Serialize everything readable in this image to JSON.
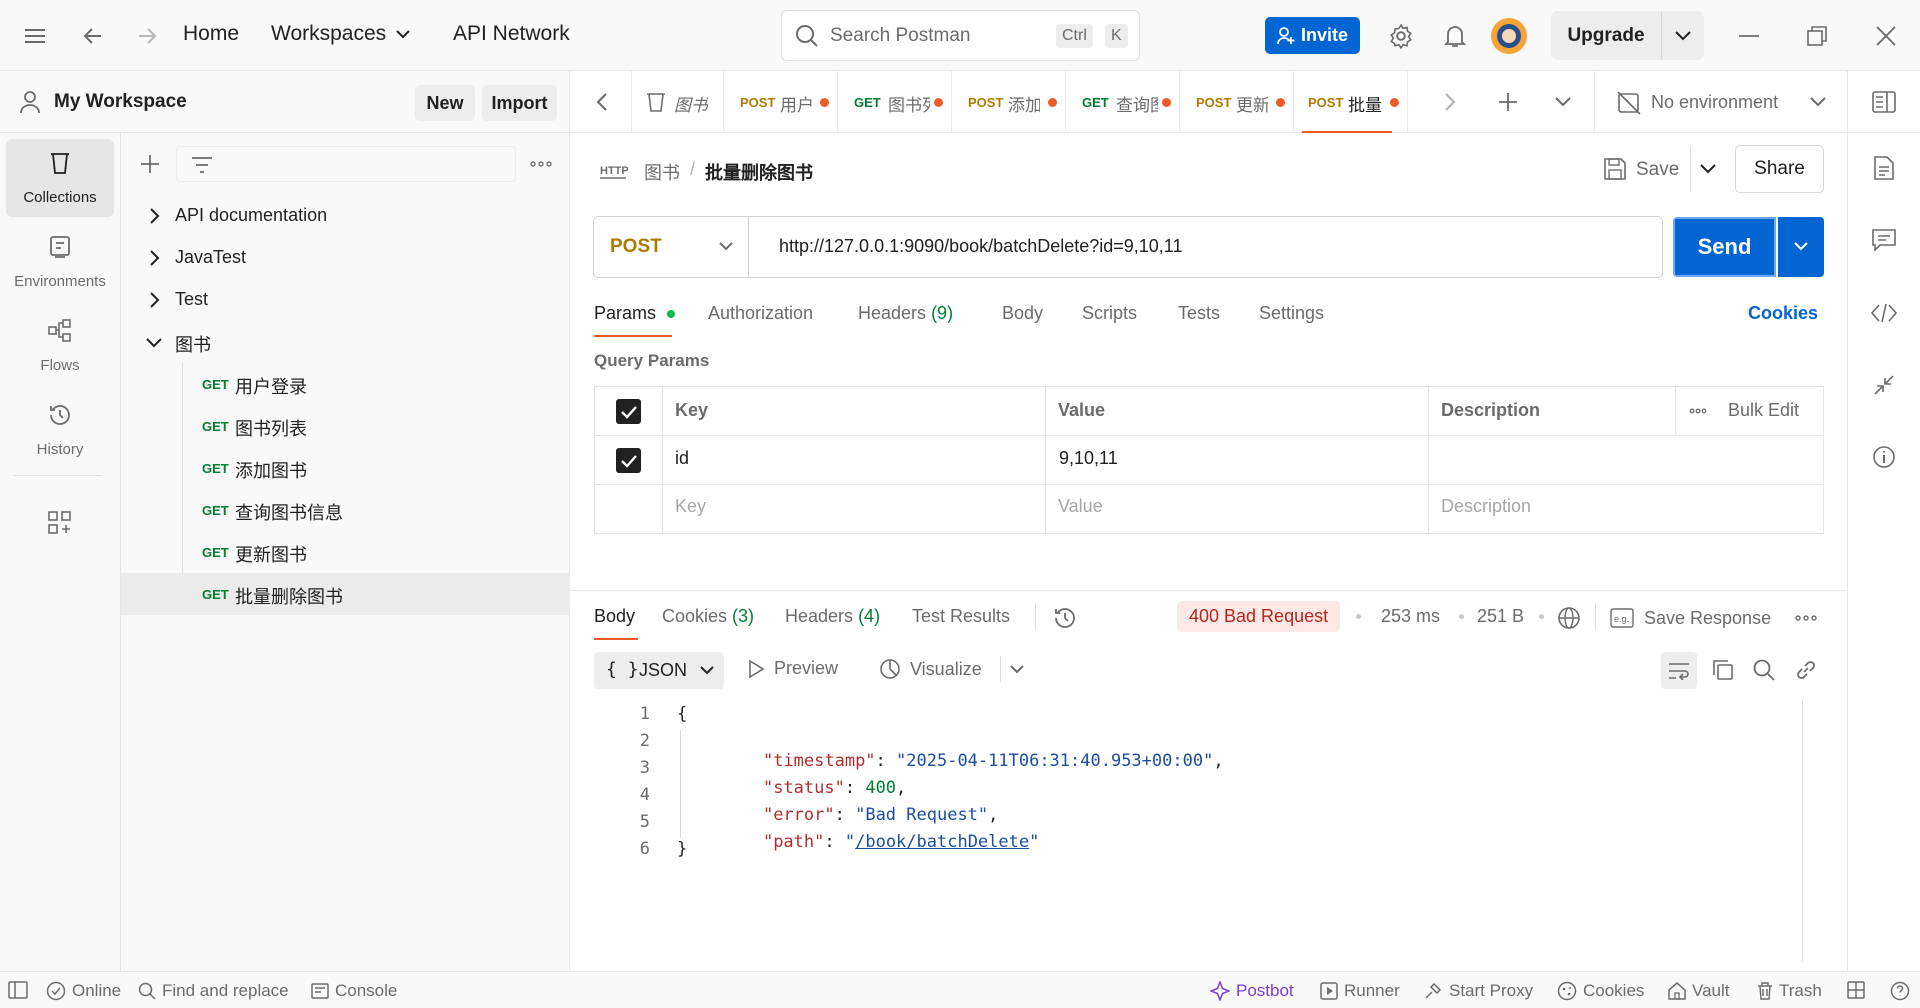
{
  "topbar": {
    "home": "Home",
    "workspaces": "Workspaces",
    "api_network": "API Network",
    "search_placeholder": "Search Postman",
    "kbd_ctrl": "Ctrl",
    "kbd_k": "K",
    "invite": "Invite",
    "upgrade": "Upgrade"
  },
  "workspace": {
    "name": "My Workspace",
    "new": "New",
    "import": "Import"
  },
  "rail": [
    "Collections",
    "Environments",
    "Flows",
    "History"
  ],
  "sidebar": {
    "collections": [
      "API documentation",
      "JavaTest",
      "Test",
      "图书"
    ],
    "requests": [
      {
        "method": "GET",
        "name": "用户登录"
      },
      {
        "method": "GET",
        "name": "图书列表"
      },
      {
        "method": "GET",
        "name": "添加图书"
      },
      {
        "method": "GET",
        "name": "查询图书信息"
      },
      {
        "method": "GET",
        "name": "更新图书"
      },
      {
        "method": "GET",
        "name": "批量删除图书"
      }
    ]
  },
  "tabs": [
    {
      "method": "",
      "name": "图书"
    },
    {
      "method": "POST",
      "name": "用户"
    },
    {
      "method": "GET",
      "name": "图书列"
    },
    {
      "method": "POST",
      "name": "添加"
    },
    {
      "method": "GET",
      "name": "查询图"
    },
    {
      "method": "POST",
      "name": "更新"
    },
    {
      "method": "POST",
      "name": "批量"
    }
  ],
  "environment": "No environment",
  "breadcrumb": {
    "parent": "图书",
    "sep": "/",
    "current": "批量删除图书"
  },
  "actions": {
    "save": "Save",
    "share": "Share"
  },
  "request": {
    "method": "POST",
    "url": "http://127.0.0.1:9090/book/batchDelete?id=9,10,11",
    "send": "Send"
  },
  "req_tabs": {
    "params": "Params",
    "authorization": "Authorization",
    "headers": "Headers",
    "headers_count": "(9)",
    "body": "Body",
    "scripts": "Scripts",
    "tests": "Tests",
    "settings": "Settings",
    "cookies": "Cookies"
  },
  "query": {
    "title": "Query Params",
    "headers": [
      "Key",
      "Value",
      "Description"
    ],
    "bulk_edit": "Bulk Edit",
    "row": {
      "key": "id",
      "value": "9,10,11",
      "description": ""
    },
    "placeholder": {
      "key": "Key",
      "value": "Value",
      "description": "Description"
    }
  },
  "response": {
    "tabs": {
      "body": "Body",
      "cookies": "Cookies",
      "cookies_count": "(3)",
      "headers": "Headers",
      "headers_count": "(4)",
      "test_results": "Test Results"
    },
    "status": "400 Bad Request",
    "time": "253 ms",
    "size": "251 B",
    "save_response": "Save Response",
    "format": "JSON",
    "preview": "Preview",
    "visualize": "Visualize",
    "lines": [
      "1",
      "2",
      "3",
      "4",
      "5",
      "6"
    ],
    "json": {
      "open": "{",
      "timestamp_key": "\"timestamp\"",
      "timestamp_val": "\"2025-04-11T06:31:40.953+00:00\"",
      "status_key": "\"status\"",
      "status_val": "400",
      "error_key": "\"error\"",
      "error_val": "\"Bad Request\"",
      "path_key": "\"path\"",
      "path_val": "/book/batchDelete",
      "close": "}"
    }
  },
  "statusbar": {
    "online": "Online",
    "find": "Find and replace",
    "console": "Console",
    "postbot": "Postbot",
    "runner": "Runner",
    "proxy": "Start Proxy",
    "cookies": "Cookies",
    "vault": "Vault",
    "trash": "Trash"
  },
  "colors": {
    "accent": "#0265d2",
    "orange": "#ef5b25",
    "get": "#007f31",
    "post": "#ad7a03"
  }
}
